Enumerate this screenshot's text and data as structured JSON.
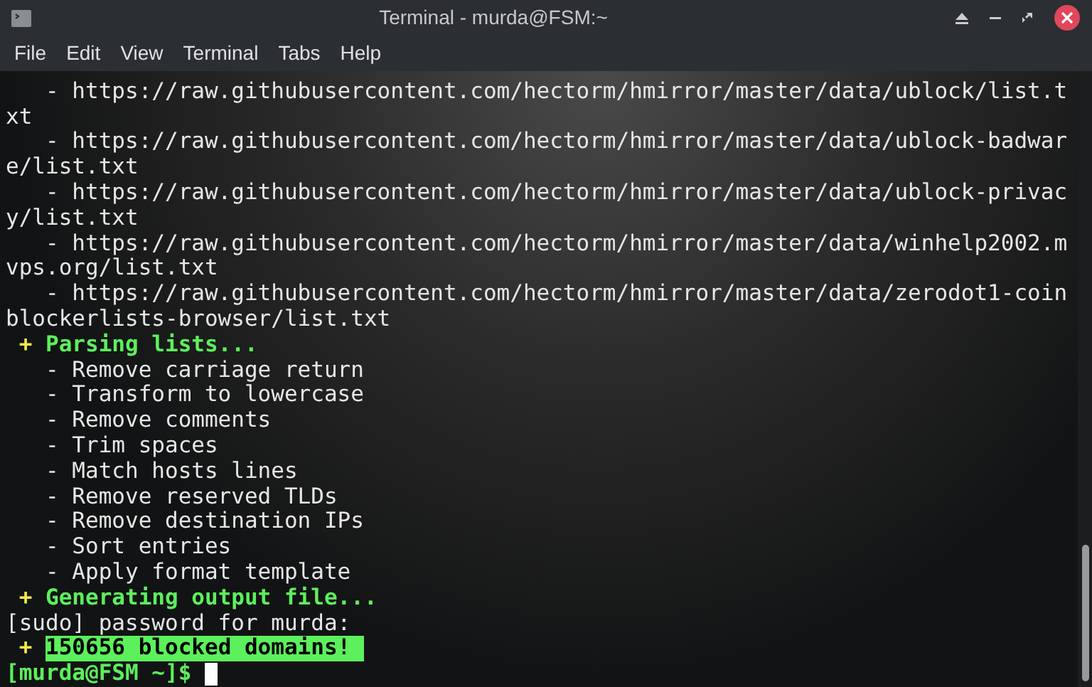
{
  "window": {
    "title": "Terminal - murda@FSM:~"
  },
  "menu": [
    "File",
    "Edit",
    "View",
    "Terminal",
    "Tabs",
    "Help"
  ],
  "lines": [
    {
      "kind": "plain",
      "text": "   - https://raw.githubusercontent.com/hectorm/hmirror/master/data/ublock/list.t"
    },
    {
      "kind": "plain",
      "text": "xt"
    },
    {
      "kind": "plain",
      "text": "   - https://raw.githubusercontent.com/hectorm/hmirror/master/data/ublock-badwar"
    },
    {
      "kind": "plain",
      "text": "e/list.txt"
    },
    {
      "kind": "plain",
      "text": "   - https://raw.githubusercontent.com/hectorm/hmirror/master/data/ublock-privac"
    },
    {
      "kind": "plain",
      "text": "y/list.txt"
    },
    {
      "kind": "plain",
      "text": "   - https://raw.githubusercontent.com/hectorm/hmirror/master/data/winhelp2002.m"
    },
    {
      "kind": "plain",
      "text": "vps.org/list.txt"
    },
    {
      "kind": "plain",
      "text": "   - https://raw.githubusercontent.com/hectorm/hmirror/master/data/zerodot1-coin"
    },
    {
      "kind": "plain",
      "text": "blockerlists-browser/list.txt"
    },
    {
      "kind": "heading",
      "marker": "+",
      "text": "Parsing lists..."
    },
    {
      "kind": "plain",
      "text": "   - Remove carriage return"
    },
    {
      "kind": "plain",
      "text": "   - Transform to lowercase"
    },
    {
      "kind": "plain",
      "text": "   - Remove comments"
    },
    {
      "kind": "plain",
      "text": "   - Trim spaces"
    },
    {
      "kind": "plain",
      "text": "   - Match hosts lines"
    },
    {
      "kind": "plain",
      "text": "   - Remove reserved TLDs"
    },
    {
      "kind": "plain",
      "text": "   - Remove destination IPs"
    },
    {
      "kind": "plain",
      "text": "   - Sort entries"
    },
    {
      "kind": "plain",
      "text": "   - Apply format template"
    },
    {
      "kind": "heading",
      "marker": "+",
      "text": "Generating output file..."
    },
    {
      "kind": "plain",
      "text": "[sudo] password for murda:"
    },
    {
      "kind": "highlight",
      "marker": "+",
      "text": "150656 blocked domains! "
    },
    {
      "kind": "prompt",
      "text": "[murda@FSM ~]$"
    }
  ]
}
